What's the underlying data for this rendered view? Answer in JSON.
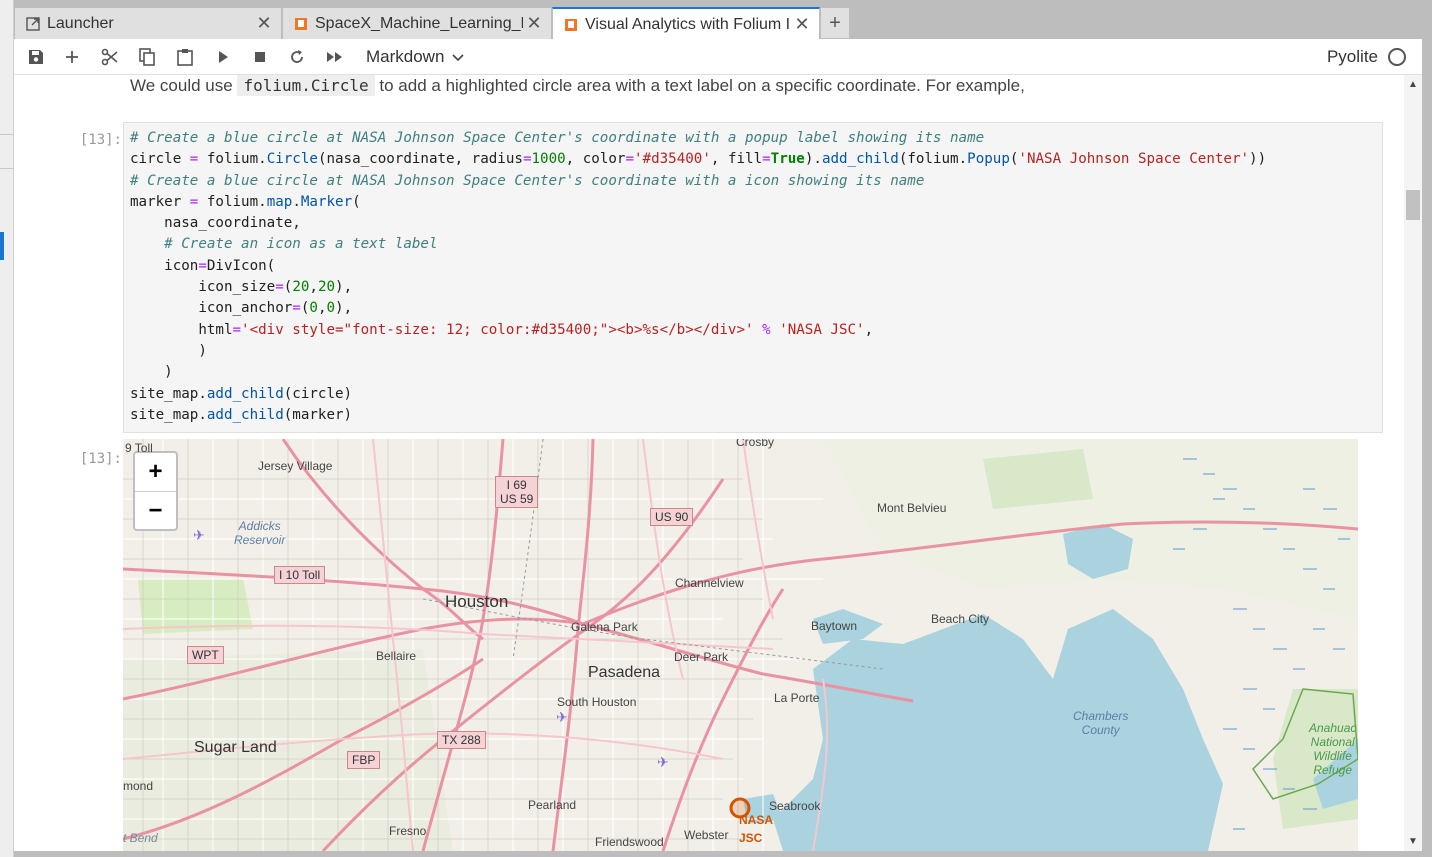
{
  "tabs": [
    {
      "label": "Launcher",
      "icon": "external-link-icon",
      "active": false
    },
    {
      "label": "SpaceX_Machine_Learning_P",
      "icon": "notebook-icon",
      "active": false
    },
    {
      "label": "Visual Analytics with Folium I",
      "icon": "notebook-icon",
      "active": true
    }
  ],
  "toolbar": {
    "cell_type": "Markdown",
    "kernel_name": "Pyolite"
  },
  "markdown": {
    "before": "We could use",
    "code": "folium.Circle",
    "after": "to add a highlighted circle area with a text label on a specific coordinate. For example,"
  },
  "cell": {
    "in_prompt": "[13]:",
    "out_prompt": "[13]:"
  },
  "map": {
    "zoom_in": "+",
    "zoom_out": "−",
    "cities": {
      "houston": "Houston",
      "pasadena": "Pasadena",
      "sugar_land": "Sugar Land"
    },
    "places": {
      "jersey_village": "Jersey Village",
      "mont_belvieu": "Mont Belvieu",
      "channelview": "Channelview",
      "galena_park": "Galena Park",
      "baytown": "Baytown",
      "beach_city": "Beach City",
      "bellaire": "Bellaire",
      "deer_park": "Deer Park",
      "south_houston": "South Houston",
      "la_porte": "La Porte",
      "pearland": "Pearland",
      "seabrook": "Seabrook",
      "fresno": "Fresno",
      "webster": "Webster",
      "friendswood": "Friendswood",
      "crosby": "Crosby",
      "mond": "mond",
      "bend": "t Bend",
      "toll": "9 Toll"
    },
    "shields": {
      "i69": "I 69\nUS 59",
      "us90": "US 90",
      "i10toll": "I 10 Toll",
      "wpt": "WPT",
      "tx288": "TX 288",
      "fbp": "FBP"
    },
    "areas": {
      "addicks": "Addicks\nReservoir",
      "chambers": "Chambers\nCounty",
      "anahuac": "Anahuac\nNational\nWildlife\nRefuge"
    },
    "marker_label": "NASA\nJSC",
    "marker_color": "#d35400"
  },
  "colors": {
    "accent": "#1976d2",
    "marker": "#d35400",
    "water": "#aad3df",
    "road": "#e892a2"
  }
}
